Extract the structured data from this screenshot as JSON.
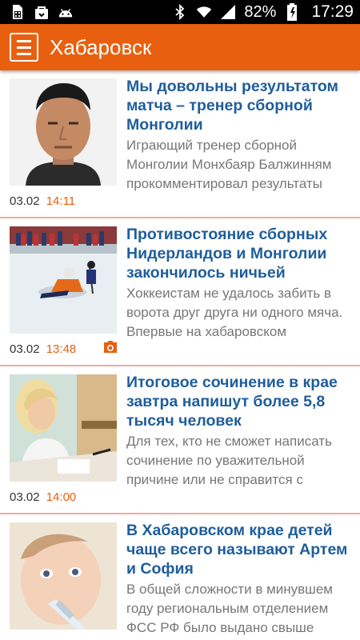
{
  "theme": {
    "accent": "#e8600f",
    "headline_color": "#1f5e9c",
    "divider_color": "#f1a9a0"
  },
  "status_bar": {
    "battery": "82%",
    "time": "17:29",
    "icons": [
      "sim-icon",
      "bag-icon",
      "android-icon",
      "bluetooth-icon",
      "wifi-icon",
      "signal-icon",
      "battery-icon"
    ]
  },
  "app_bar": {
    "title": "Хабаровск",
    "menu_icon": "hamburger-menu-icon"
  },
  "articles": [
    {
      "headline": "Мы довольны результатом матча – тренер сборной Монголии",
      "lead": "Играющий тренер сборной Монголии Монхбаяр Балжинням прокомментировал результаты",
      "date": "03.02",
      "time": "14:11",
      "photo_gallery": false
    },
    {
      "headline": "Противостояние сборных Нидерландов и Монголии закончилось ничьей",
      "lead": "Хоккеистам не удалось забить в ворота друг друга ни одного мяча. Впервые на хабаровском",
      "date": "03.02",
      "time": "13:48",
      "photo_gallery": true
    },
    {
      "headline": "Итоговое сочинение в крае завтра напишут более 5,8 тысяч человек",
      "lead": "Для тех, кто не сможет написать сочинение по уважительной причине или не справится с",
      "date": "03.02",
      "time": "14:00",
      "photo_gallery": false
    },
    {
      "headline": "В Хабаровском крае детей чаще всего называют Артем и София",
      "lead": "В общей сложности в минувшем году региональным отделением ФСС РФ было выдано свыше",
      "date": "",
      "time": "",
      "photo_gallery": false
    }
  ]
}
